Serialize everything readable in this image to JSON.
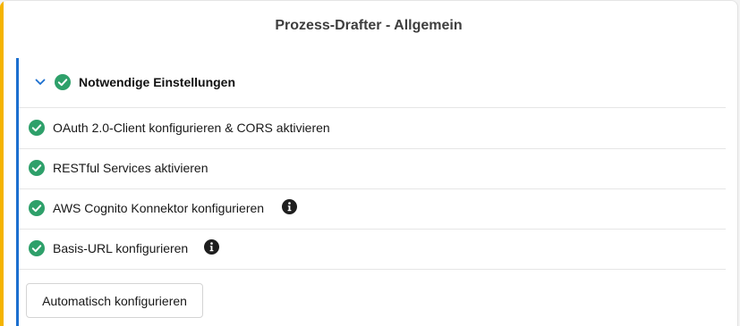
{
  "panel": {
    "title": "Prozess-Drafter - Allgemein"
  },
  "section": {
    "title": "Notwendige Einstellungen",
    "status_icon": "check-circle-icon",
    "expanded": true,
    "items": [
      {
        "label": "OAuth 2.0-Client konfigurieren & CORS aktivieren",
        "status_icon": "check-circle-icon",
        "info": false
      },
      {
        "label": "RESTful Services aktivieren",
        "status_icon": "check-circle-icon",
        "info": false
      },
      {
        "label": "AWS Cognito Konnektor konfigurieren",
        "status_icon": "check-circle-icon",
        "info": true
      },
      {
        "label": "Basis-URL konfigurieren",
        "status_icon": "check-circle-icon",
        "info": true
      }
    ]
  },
  "actions": {
    "auto_configure_label": "Automatisch konfigurieren"
  },
  "colors": {
    "panel_accent": "#f5b400",
    "section_accent": "#1b6fcf",
    "success": "#2ea06a"
  }
}
